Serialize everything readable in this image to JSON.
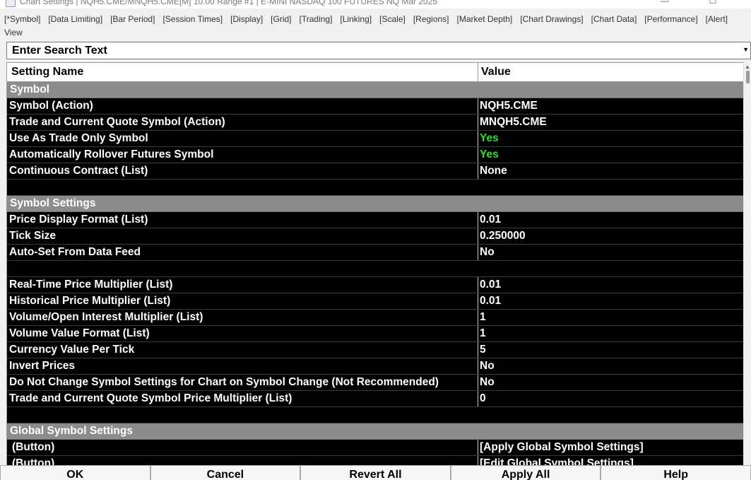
{
  "window": {
    "title": "Chart Settings | NQH5.CME/MNQH5.CME[M]  10.00 Range #1 | E-MINI NASDAQ 100 FUTURES NQ Mar 2025",
    "minimize_glyph": "—",
    "maximize_glyph": "☐"
  },
  "tabs": [
    {
      "label": "[*Symbol]"
    },
    {
      "label": "[Data Limiting]"
    },
    {
      "label": "[Bar Period]"
    },
    {
      "label": "[Session Times]"
    },
    {
      "label": "[Display]"
    },
    {
      "label": "[Grid]"
    },
    {
      "label": "[Trading]"
    },
    {
      "label": "[Linking]"
    },
    {
      "label": "[Scale]"
    },
    {
      "label": "[Regions]"
    },
    {
      "label": "[Market Depth]"
    },
    {
      "label": "[Chart Drawings]"
    },
    {
      "label": "[Chart Data]"
    },
    {
      "label": "[Performance]"
    },
    {
      "label": "[Alert]"
    },
    {
      "label": "View"
    }
  ],
  "search": {
    "placeholder": "Enter Search Text",
    "dropdown_glyph": "▼"
  },
  "grid": {
    "col_name": "Setting Name",
    "col_value": "Value"
  },
  "rows": [
    {
      "type": "section",
      "name": "Symbol"
    },
    {
      "type": "setting",
      "name": "Symbol (Action)",
      "value": "NQH5.CME",
      "highlight": false
    },
    {
      "type": "setting",
      "name": "Trade and Current Quote Symbol (Action)",
      "value": "MNQH5.CME",
      "highlight": false
    },
    {
      "type": "setting",
      "name": "Use As Trade Only Symbol",
      "value": "Yes",
      "highlight": true
    },
    {
      "type": "setting",
      "name": "Automatically Rollover Futures Symbol",
      "value": "Yes",
      "highlight": true
    },
    {
      "type": "setting",
      "name": "Continuous Contract (List)",
      "value": "None",
      "highlight": false
    },
    {
      "type": "blank"
    },
    {
      "type": "section",
      "name": "Symbol Settings"
    },
    {
      "type": "setting",
      "name": "Price Display Format (List)",
      "value": "0.01",
      "highlight": false
    },
    {
      "type": "setting",
      "name": "Tick Size",
      "value": "0.250000",
      "highlight": false
    },
    {
      "type": "setting",
      "name": "Auto-Set From Data Feed",
      "value": "No",
      "highlight": false
    },
    {
      "type": "blank"
    },
    {
      "type": "setting",
      "name": "Real-Time Price Multiplier (List)",
      "value": "0.01",
      "highlight": false
    },
    {
      "type": "setting",
      "name": "Historical Price Multiplier (List)",
      "value": "0.01",
      "highlight": false
    },
    {
      "type": "setting",
      "name": "Volume/Open Interest Multiplier (List)",
      "value": "1",
      "highlight": false
    },
    {
      "type": "setting",
      "name": "Volume Value Format (List)",
      "value": "1",
      "highlight": false
    },
    {
      "type": "setting",
      "name": "Currency Value Per Tick",
      "value": "5",
      "highlight": false
    },
    {
      "type": "setting",
      "name": "Invert Prices",
      "value": "No",
      "highlight": false
    },
    {
      "type": "setting",
      "name": "Do Not Change Symbol Settings for Chart on Symbol Change (Not Recommended)",
      "value": "No",
      "highlight": false
    },
    {
      "type": "setting",
      "name": "Trade and Current Quote Symbol Price Multiplier (List)",
      "value": "0",
      "highlight": false
    },
    {
      "type": "blank"
    },
    {
      "type": "section",
      "name": "Global Symbol Settings"
    },
    {
      "type": "button",
      "name": "(Button)",
      "value": "[Apply Global Symbol Settings]",
      "highlight": false
    },
    {
      "type": "button",
      "name": "(Button)",
      "value": "[Edit Global Symbol Settings]",
      "highlight": false
    }
  ],
  "scrollbar": {
    "up_glyph": "▲"
  },
  "footer": {
    "buttons": [
      {
        "label": "OK",
        "name": "ok-button"
      },
      {
        "label": "Cancel",
        "name": "cancel-button"
      },
      {
        "label": "Revert All",
        "name": "revert-all-button"
      },
      {
        "label": "Apply All",
        "name": "apply-all-button"
      },
      {
        "label": "Help",
        "name": "help-button"
      }
    ]
  }
}
